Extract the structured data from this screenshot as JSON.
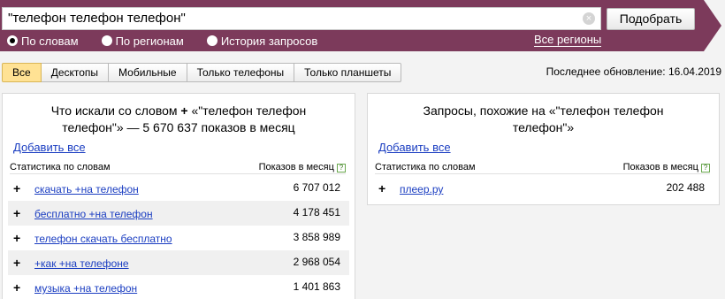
{
  "search": {
    "query": "\"телефон телефон телефон\"",
    "clear_icon": "×",
    "button": "Подобрать"
  },
  "modes": [
    {
      "label": "По словам",
      "selected": true
    },
    {
      "label": "По регионам",
      "selected": false
    },
    {
      "label": "История запросов",
      "selected": false
    }
  ],
  "regions_link": "Все регионы",
  "tabs": [
    {
      "label": "Все",
      "active": true
    },
    {
      "label": "Десктопы",
      "active": false
    },
    {
      "label": "Мобильные",
      "active": false
    },
    {
      "label": "Только телефоны",
      "active": false
    },
    {
      "label": "Только планшеты",
      "active": false
    }
  ],
  "updated": "Последнее обновление: 16.04.2019",
  "left_panel": {
    "title_line1": "Что искали со словом",
    "plus": "+",
    "title_line1_tail": "«\"телефон телефон",
    "title_line2": "телефон\"» — 5 670 637 показов в месяц",
    "add_all": "Добавить все",
    "col_words": "Статистика по словам",
    "col_shows": "Показов в месяц",
    "help": "?",
    "rows": [
      {
        "plus": "+",
        "keyword": "скачать +на телефон",
        "count": "6 707 012"
      },
      {
        "plus": "+",
        "keyword": "бесплатно +на телефон",
        "count": "4 178 451"
      },
      {
        "plus": "+",
        "keyword": "телефон скачать бесплатно",
        "count": "3 858 989"
      },
      {
        "plus": "+",
        "keyword": "+как +на телефоне",
        "count": "2 968 054"
      },
      {
        "plus": "+",
        "keyword": "музыка +на телефон",
        "count": "1 401 863"
      }
    ]
  },
  "right_panel": {
    "title_line1": "Запросы, похожие на «\"телефон телефон",
    "title_line2": "телефон\"»",
    "add_all": "Добавить все",
    "col_words": "Статистика по словам",
    "col_shows": "Показов в месяц",
    "help": "?",
    "rows": [
      {
        "plus": "+",
        "keyword": "плеер.ру",
        "count": "202 488"
      }
    ]
  },
  "colors": {
    "topbar": "#7c3a5b",
    "link": "#1a3dc1",
    "active_tab": "#ffe294"
  }
}
